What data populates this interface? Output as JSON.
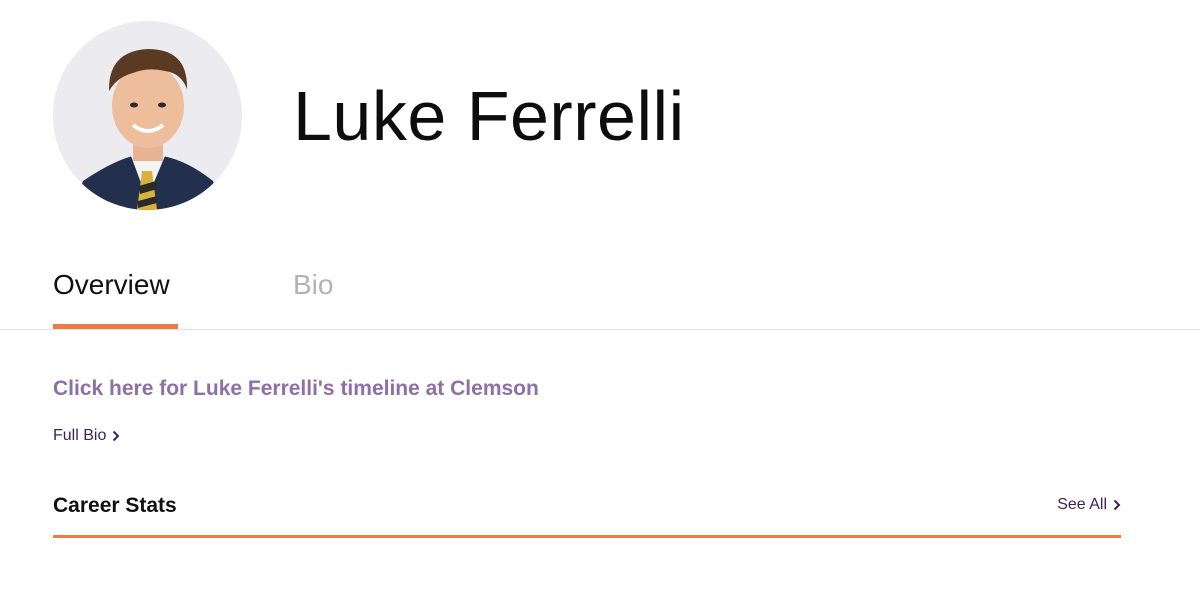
{
  "player": {
    "name": "Luke Ferrelli"
  },
  "tabs": [
    {
      "label": "Overview",
      "active": true
    },
    {
      "label": "Bio",
      "active": false
    }
  ],
  "overview": {
    "timeline_link": "Click here for Luke Ferrelli's timeline at Clemson",
    "full_bio_link": "Full Bio",
    "career_stats": {
      "title": "Career Stats",
      "see_all_link": "See All"
    }
  },
  "icons": {
    "chevron": "chevron-right-icon"
  },
  "colors": {
    "accent": "#ef7a48",
    "link_purple": "#8e6fa6",
    "dark_purple": "#3d1f5c",
    "inactive_tab": "#b3b3b3"
  }
}
